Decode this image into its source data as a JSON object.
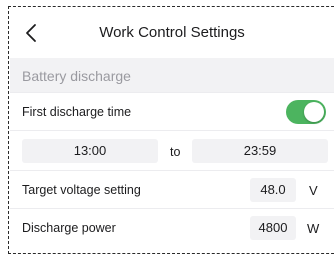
{
  "header": {
    "title": "Work Control Settings",
    "back_icon": "chevron-left-icon"
  },
  "section": {
    "title": "Battery discharge"
  },
  "first_discharge": {
    "label": "First discharge time",
    "enabled": true,
    "toggle_color": "#4cb45f"
  },
  "time_range": {
    "start": "13:00",
    "separator": "to",
    "end": "23:59"
  },
  "target_voltage": {
    "label": "Target voltage setting",
    "value": "48.0",
    "unit": "V"
  },
  "discharge_power": {
    "label": "Discharge power",
    "value": "4800",
    "unit": "W"
  }
}
